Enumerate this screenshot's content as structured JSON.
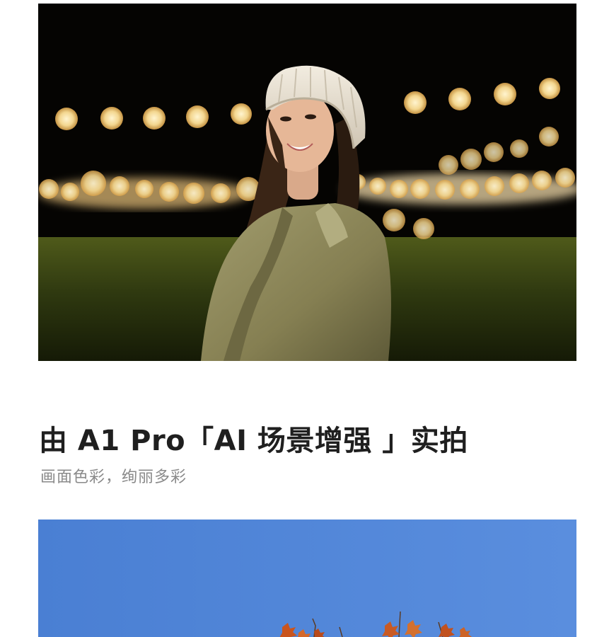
{
  "caption": {
    "title": "由 A1 Pro「AI 场景增强 」实拍",
    "subtitle": "画面色彩，绚丽多彩"
  },
  "colors": {
    "title": "#1f1f1f",
    "subtitle": "#8a8a8a",
    "sky": "#4f86d8",
    "night_background": "#050402",
    "bokeh": "#f6dc9a",
    "jacket": "#8f8a5c"
  },
  "icons": {
    "photo_night": "night-portrait-photo",
    "photo_sky": "sky-foliage-photo"
  }
}
